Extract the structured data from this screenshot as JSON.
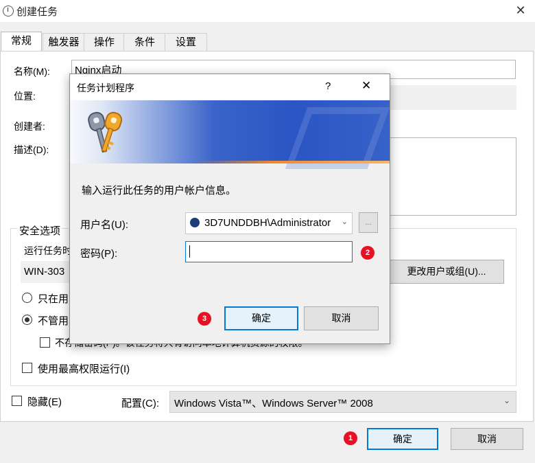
{
  "main_window": {
    "title": "创建任务",
    "close_glyph": "✕",
    "tabs": [
      "常规",
      "触发器",
      "操作",
      "条件",
      "设置"
    ],
    "general": {
      "name_label": "名称(M):",
      "name_value": "Nginx启动",
      "location_label": "位置:",
      "author_label": "创建者:",
      "description_label": "描述(D):",
      "security_group_label": "安全选项",
      "run_as_label": "运行任务时",
      "run_as_value": "WIN-303",
      "change_user_button": "更改用户或组(U)...",
      "radio_logged_on": "只在用",
      "radio_whether_logged_on": "不管用",
      "do_not_store_password": "不存储密码(P)。该任务将只有访问本地计算机资源的权限。",
      "run_highest": "使用最高权限运行(I)",
      "hidden_label": "隐藏(E)",
      "configure_label": "配置(C):",
      "configure_value": "Windows Vista™、Windows Server™ 2008"
    },
    "ok_button": "确定",
    "cancel_button": "取消"
  },
  "dialog": {
    "title": "任务计划程序",
    "help_glyph": "?",
    "close_glyph": "✕",
    "prompt": "输入运行此任务的用户帐户信息。",
    "username_label": "用户名(U):",
    "username_value": "3D7UNDDBH\\Administrator",
    "browse_label": "...",
    "password_label": "密码(P):",
    "password_value": "",
    "ok_button": "确定",
    "cancel_button": "取消"
  },
  "badges": [
    "1",
    "2",
    "3"
  ],
  "icons": [
    "clock-icon",
    "keys-icon",
    "user-icon",
    "chevron-down-icon",
    "close-icon"
  ],
  "colors": {
    "accent": "#0078d7",
    "badge": "#e81123",
    "banner": "#2b55c4"
  }
}
